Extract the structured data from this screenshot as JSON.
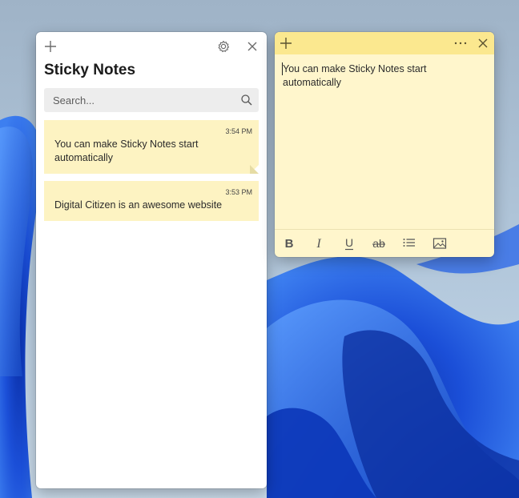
{
  "list_window": {
    "title": "Sticky Notes",
    "add_icon": "plus-icon",
    "settings_icon": "gear-icon",
    "close_icon": "close-icon",
    "search": {
      "placeholder": "Search...",
      "icon": "search-icon"
    },
    "notes": [
      {
        "time": "3:54 PM",
        "text": "You can make Sticky Notes start automatically",
        "selected": true
      },
      {
        "time": "3:53 PM",
        "text": "Digital Citizen is an awesome website",
        "selected": false
      }
    ]
  },
  "note_window": {
    "add_icon": "plus-icon",
    "menu_icon": "more-icon",
    "close_icon": "close-icon",
    "content": "You can make Sticky Notes start automatically",
    "toolbar": [
      "bold-icon",
      "italic-icon",
      "underline-icon",
      "strikethrough-icon",
      "bullet-list-icon",
      "image-icon"
    ]
  },
  "colors": {
    "note_background": "#fff6cc",
    "note_header": "#fbe88f",
    "note_card": "#fdf3c2",
    "desktop_blue": "#1a56d6"
  }
}
